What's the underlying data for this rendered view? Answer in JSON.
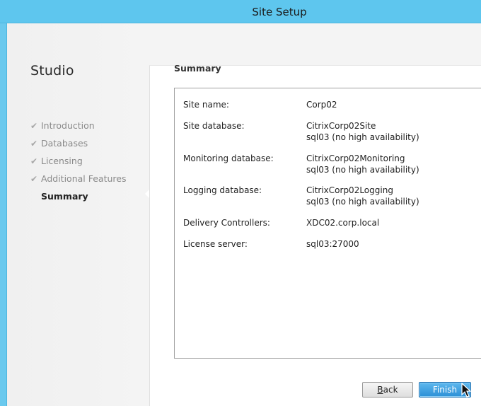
{
  "window": {
    "title": "Site Setup"
  },
  "sidebar": {
    "brand": "Studio",
    "steps": [
      {
        "label": "Introduction",
        "done": true
      },
      {
        "label": "Databases",
        "done": true
      },
      {
        "label": "Licensing",
        "done": true
      },
      {
        "label": "Additional Features",
        "done": true
      },
      {
        "label": "Summary",
        "done": false,
        "current": true
      }
    ]
  },
  "main": {
    "section_title": "Summary",
    "summary": [
      {
        "label": "Site name:",
        "values": [
          "Corp02"
        ]
      },
      {
        "label": "Site database:",
        "values": [
          "CitrixCorp02Site",
          "sql03 (no high availability)"
        ]
      },
      {
        "label": "Monitoring database:",
        "values": [
          "CitrixCorp02Monitoring",
          "sql03 (no high availability)"
        ]
      },
      {
        "label": "Logging database:",
        "values": [
          "CitrixCorp02Logging",
          "sql03 (no high availability)"
        ]
      },
      {
        "label": "Delivery Controllers:",
        "values": [
          "XDC02.corp.local"
        ]
      },
      {
        "label": "License server:",
        "values": [
          "sql03:27000"
        ]
      }
    ]
  },
  "footer": {
    "back_label_prefix": "",
    "back_label_mnemonic": "B",
    "back_label_rest": "ack",
    "finish_label": "Finish"
  },
  "icons": {
    "check": "checkmark-icon",
    "cursor": "mouse-pointer-icon"
  },
  "colors": {
    "titlebar": "#5ec6ee",
    "finish_button": "#2a8fd6"
  }
}
